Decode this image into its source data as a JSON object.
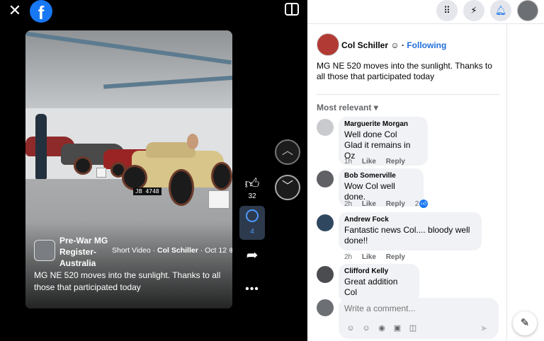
{
  "viewer": {
    "close_glyph": "✕",
    "logo_letter": "f",
    "video": {
      "page_name": "Pre-War MG Register-Australia",
      "type_label": "Short Video",
      "author": "Col Schiller",
      "date": "Oct 12",
      "caption": "MG NE 520 moves into the sunlight. Thanks to all those that participated today",
      "plate": "JB 4748"
    },
    "like_count": "32",
    "comment_count": "4"
  },
  "post": {
    "author": "Col Schiller",
    "following_label": "Following",
    "text": "MG NE 520 moves into the sunlight. Thanks to all those that participated today",
    "sort_label": "Most relevant"
  },
  "comments": [
    {
      "name": "Marguerite Morgan",
      "text": "Well done Col\nGlad it remains in Oz",
      "time": "1h",
      "like": "Like",
      "reply": "Reply",
      "reactions": ""
    },
    {
      "name": "Bob Somerville",
      "text": "Wow Col well done.",
      "time": "2h",
      "like": "Like",
      "reply": "Reply",
      "reactions": "2"
    },
    {
      "name": "Andrew Fock",
      "text": "Fantastic news Col.... bloody well done!!",
      "time": "2h",
      "like": "Like",
      "reply": "Reply",
      "reactions": ""
    },
    {
      "name": "Clifford Kelly",
      "text": "Great addition Col",
      "time": "",
      "like": "",
      "reply": "",
      "reactions": ""
    }
  ],
  "composer": {
    "placeholder": "Write a comment..."
  },
  "colors": {
    "accent": "#1877f2",
    "following": "#216fdb"
  }
}
